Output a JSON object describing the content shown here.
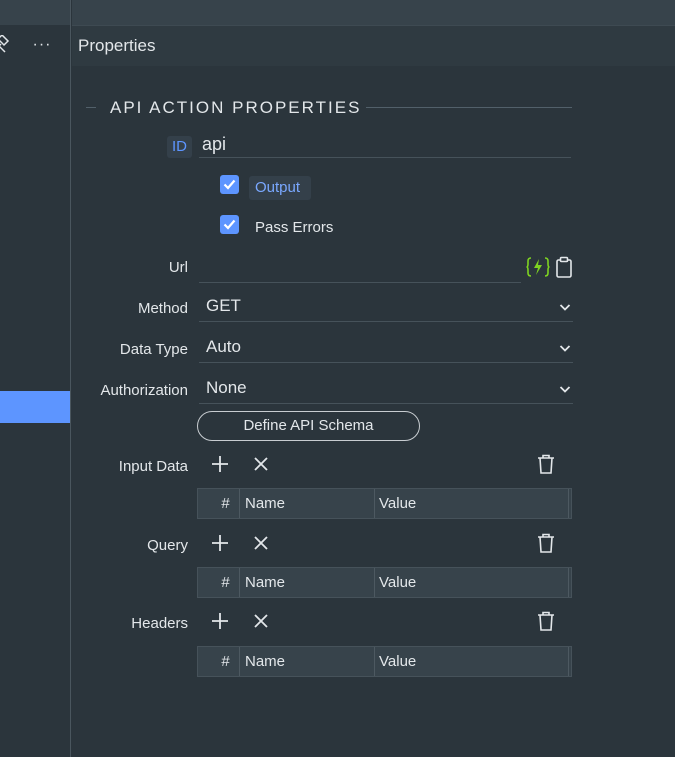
{
  "left_toolbar": {
    "pin_icon": "pin-icon",
    "more_label": "···"
  },
  "panel": {
    "title": "Properties",
    "section_title": "API ACTION PROPERTIES"
  },
  "id_field": {
    "badge": "ID",
    "value": "api"
  },
  "checkboxes": [
    {
      "label": "Output",
      "checked": true
    },
    {
      "label": "Pass Errors",
      "checked": true
    }
  ],
  "url": {
    "label": "Url",
    "value": "",
    "icons": [
      "dynamic-data-icon",
      "clipboard-icon"
    ]
  },
  "method": {
    "label": "Method",
    "value": "GET"
  },
  "data_type": {
    "label": "Data Type",
    "value": "Auto"
  },
  "authorization": {
    "label": "Authorization",
    "value": "None"
  },
  "define_schema_button": "Define API Schema",
  "groups": [
    {
      "label": "Input Data",
      "columns": [
        "#",
        "Name",
        "Value"
      ]
    },
    {
      "label": "Query",
      "columns": [
        "#",
        "Name",
        "Value"
      ]
    },
    {
      "label": "Headers",
      "columns": [
        "#",
        "Name",
        "Value"
      ]
    }
  ],
  "colors": {
    "accent": "#5d95ff",
    "background": "#2b353c",
    "dynamic_icon": "#7ed321"
  }
}
